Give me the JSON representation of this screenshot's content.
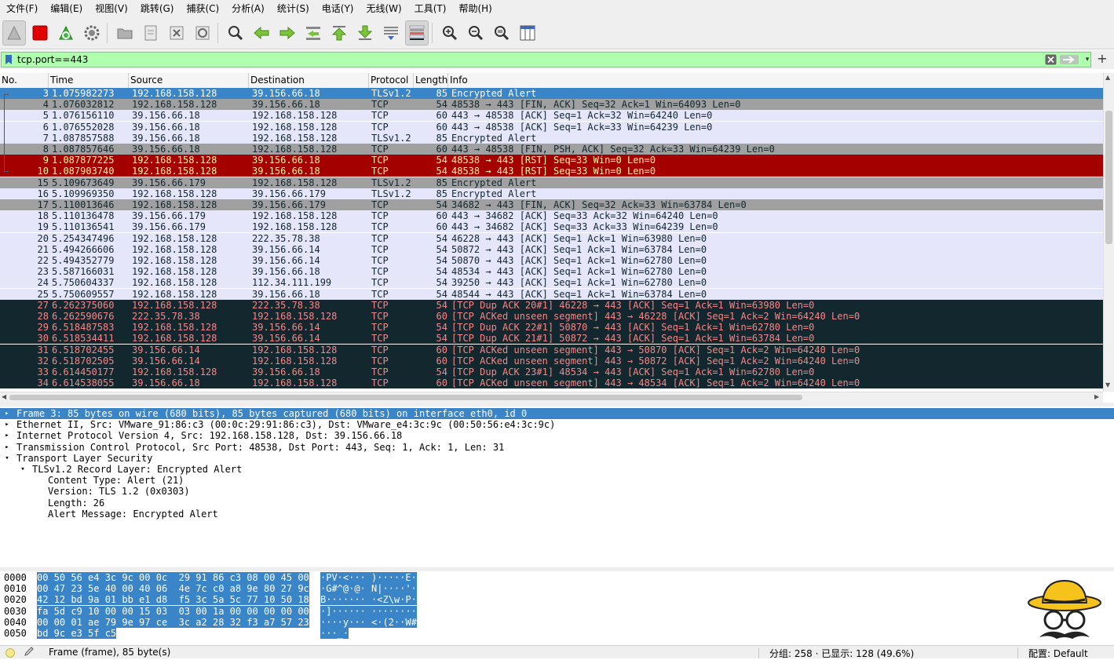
{
  "menubar": {
    "items": [
      "文件(F)",
      "编辑(E)",
      "视图(V)",
      "跳转(G)",
      "捕获(C)",
      "分析(A)",
      "统计(S)",
      "电话(Y)",
      "无线(W)",
      "工具(T)",
      "帮助(H)"
    ]
  },
  "filter": {
    "value": "tcp.port==443",
    "accent_color": "#afffaf"
  },
  "packet_list": {
    "columns": [
      "No.",
      "Time",
      "Source",
      "Destination",
      "Protocol",
      "Length",
      "Info"
    ],
    "rows": [
      {
        "no": "3",
        "time": "1.075982273",
        "src": "192.168.158.128",
        "dst": "39.156.66.18",
        "proto": "TLSv1.2",
        "len": "85",
        "info": "Encrypted Alert",
        "style": "selected"
      },
      {
        "no": "4",
        "time": "1.076032812",
        "src": "192.168.158.128",
        "dst": "39.156.66.18",
        "proto": "TCP",
        "len": "54",
        "info": "48538 → 443 [FIN, ACK] Seq=32 Ack=1 Win=64093 Len=0",
        "style": "grey"
      },
      {
        "no": "5",
        "time": "1.076156110",
        "src": "39.156.66.18",
        "dst": "192.168.158.128",
        "proto": "TCP",
        "len": "60",
        "info": "443 → 48538 [ACK] Seq=1 Ack=32 Win=64240 Len=0",
        "style": "lavender"
      },
      {
        "no": "6",
        "time": "1.076552028",
        "src": "39.156.66.18",
        "dst": "192.168.158.128",
        "proto": "TCP",
        "len": "60",
        "info": "443 → 48538 [ACK] Seq=1 Ack=33 Win=64239 Len=0",
        "style": "lavender"
      },
      {
        "no": "7",
        "time": "1.087857588",
        "src": "39.156.66.18",
        "dst": "192.168.158.128",
        "proto": "TLSv1.2",
        "len": "85",
        "info": "Encrypted Alert",
        "style": "lavender"
      },
      {
        "no": "8",
        "time": "1.087857646",
        "src": "39.156.66.18",
        "dst": "192.168.158.128",
        "proto": "TCP",
        "len": "60",
        "info": "443 → 48538 [FIN, PSH, ACK] Seq=32 Ack=33 Win=64239 Len=0",
        "style": "grey"
      },
      {
        "no": "9",
        "time": "1.087877225",
        "src": "192.168.158.128",
        "dst": "39.156.66.18",
        "proto": "TCP",
        "len": "54",
        "info": "48538 → 443 [RST] Seq=33 Win=0 Len=0",
        "style": "red"
      },
      {
        "no": "10",
        "time": "1.087903740",
        "src": "192.168.158.128",
        "dst": "39.156.66.18",
        "proto": "TCP",
        "len": "54",
        "info": "48538 → 443 [RST] Seq=33 Win=0 Len=0",
        "style": "red"
      },
      {
        "no": "15",
        "time": "5.109673649",
        "src": "39.156.66.179",
        "dst": "192.168.158.128",
        "proto": "TLSv1.2",
        "len": "85",
        "info": "Encrypted Alert",
        "style": "grey"
      },
      {
        "no": "16",
        "time": "5.109969350",
        "src": "192.168.158.128",
        "dst": "39.156.66.179",
        "proto": "TLSv1.2",
        "len": "85",
        "info": "Encrypted Alert",
        "style": "lavender"
      },
      {
        "no": "17",
        "time": "5.110013646",
        "src": "192.168.158.128",
        "dst": "39.156.66.179",
        "proto": "TCP",
        "len": "54",
        "info": "34682 → 443 [FIN, ACK] Seq=32 Ack=33 Win=63784 Len=0",
        "style": "grey"
      },
      {
        "no": "18",
        "time": "5.110136478",
        "src": "39.156.66.179",
        "dst": "192.168.158.128",
        "proto": "TCP",
        "len": "60",
        "info": "443 → 34682 [ACK] Seq=33 Ack=32 Win=64240 Len=0",
        "style": "lavender"
      },
      {
        "no": "19",
        "time": "5.110136541",
        "src": "39.156.66.179",
        "dst": "192.168.158.128",
        "proto": "TCP",
        "len": "60",
        "info": "443 → 34682 [ACK] Seq=33 Ack=33 Win=64239 Len=0",
        "style": "lavender"
      },
      {
        "no": "20",
        "time": "5.254347496",
        "src": "192.168.158.128",
        "dst": "222.35.78.38",
        "proto": "TCP",
        "len": "54",
        "info": "46228 → 443 [ACK] Seq=1 Ack=1 Win=63980 Len=0",
        "style": "lavender"
      },
      {
        "no": "21",
        "time": "5.494266606",
        "src": "192.168.158.128",
        "dst": "39.156.66.14",
        "proto": "TCP",
        "len": "54",
        "info": "50872 → 443 [ACK] Seq=1 Ack=1 Win=63784 Len=0",
        "style": "lavender"
      },
      {
        "no": "22",
        "time": "5.494352779",
        "src": "192.168.158.128",
        "dst": "39.156.66.14",
        "proto": "TCP",
        "len": "54",
        "info": "50870 → 443 [ACK] Seq=1 Ack=1 Win=62780 Len=0",
        "style": "lavender"
      },
      {
        "no": "23",
        "time": "5.587166031",
        "src": "192.168.158.128",
        "dst": "39.156.66.18",
        "proto": "TCP",
        "len": "54",
        "info": "48534 → 443 [ACK] Seq=1 Ack=1 Win=62780 Len=0",
        "style": "lavender"
      },
      {
        "no": "24",
        "time": "5.750604337",
        "src": "192.168.158.128",
        "dst": "112.34.111.199",
        "proto": "TCP",
        "len": "54",
        "info": "39250 → 443 [ACK] Seq=1 Ack=1 Win=62780 Len=0",
        "style": "lavender"
      },
      {
        "no": "25",
        "time": "5.750609557",
        "src": "192.168.158.128",
        "dst": "39.156.66.18",
        "proto": "TCP",
        "len": "54",
        "info": "48544 → 443 [ACK] Seq=1 Ack=1 Win=63784 Len=0",
        "style": "lavender"
      },
      {
        "no": "27",
        "time": "6.262375060",
        "src": "192.168.158.128",
        "dst": "222.35.78.38",
        "proto": "TCP",
        "len": "54",
        "info": "[TCP Dup ACK 20#1] 46228 → 443 [ACK] Seq=1 Ack=1 Win=63980 Len=0",
        "style": "dark"
      },
      {
        "no": "28",
        "time": "6.262590676",
        "src": "222.35.78.38",
        "dst": "192.168.158.128",
        "proto": "TCP",
        "len": "60",
        "info": "[TCP ACKed unseen segment] 443 → 46228 [ACK] Seq=1 Ack=2 Win=64240 Len=0",
        "style": "dark"
      },
      {
        "no": "29",
        "time": "6.518487583",
        "src": "192.168.158.128",
        "dst": "39.156.66.14",
        "proto": "TCP",
        "len": "54",
        "info": "[TCP Dup ACK 22#1] 50870 → 443 [ACK] Seq=1 Ack=1 Win=62780 Len=0",
        "style": "dark"
      },
      {
        "no": "30",
        "time": "6.518534411",
        "src": "192.168.158.128",
        "dst": "39.156.66.14",
        "proto": "TCP",
        "len": "54",
        "info": "[TCP Dup ACK 21#1] 50872 → 443 [ACK] Seq=1 Ack=1 Win=63784 Len=0",
        "style": "dark"
      },
      {
        "no": "31",
        "time": "6.518702455",
        "src": "39.156.66.14",
        "dst": "192.168.158.128",
        "proto": "TCP",
        "len": "60",
        "info": "[TCP ACKed unseen segment] 443 → 50870 [ACK] Seq=1 Ack=2 Win=64240 Len=0",
        "style": "dark"
      },
      {
        "no": "32",
        "time": "6.518702505",
        "src": "39.156.66.14",
        "dst": "192.168.158.128",
        "proto": "TCP",
        "len": "60",
        "info": "[TCP ACKed unseen segment] 443 → 50872 [ACK] Seq=1 Ack=2 Win=64240 Len=0",
        "style": "dark"
      },
      {
        "no": "33",
        "time": "6.614450177",
        "src": "192.168.158.128",
        "dst": "39.156.66.18",
        "proto": "TCP",
        "len": "54",
        "info": "[TCP Dup ACK 23#1] 48534 → 443 [ACK] Seq=1 Ack=1 Win=62780 Len=0",
        "style": "dark"
      },
      {
        "no": "34",
        "time": "6.614538055",
        "src": "39.156.66.18",
        "dst": "192.168.158.128",
        "proto": "TCP",
        "len": "60",
        "info": "[TCP ACKed unseen segment] 443 → 48534 [ACK] Seq=1 Ack=2 Win=64240 Len=0",
        "style": "dark"
      }
    ]
  },
  "details": {
    "rows": [
      {
        "indent": 0,
        "arrow": "right",
        "text": "Frame 3: 85 bytes on wire (680 bits), 85 bytes captured (680 bits) on interface eth0, id 0",
        "selected": true
      },
      {
        "indent": 0,
        "arrow": "right",
        "text": "Ethernet II, Src: VMware_91:86:c3 (00:0c:29:91:86:c3), Dst: VMware_e4:3c:9c (00:50:56:e4:3c:9c)",
        "selected": false
      },
      {
        "indent": 0,
        "arrow": "right",
        "text": "Internet Protocol Version 4, Src: 192.168.158.128, Dst: 39.156.66.18",
        "selected": false
      },
      {
        "indent": 0,
        "arrow": "right",
        "text": "Transmission Control Protocol, Src Port: 48538, Dst Port: 443, Seq: 1, Ack: 1, Len: 31",
        "selected": false
      },
      {
        "indent": 0,
        "arrow": "down",
        "text": "Transport Layer Security",
        "selected": false
      },
      {
        "indent": 1,
        "arrow": "down",
        "text": "TLSv1.2 Record Layer: Encrypted Alert",
        "selected": false
      },
      {
        "indent": 2,
        "arrow": "",
        "text": "Content Type: Alert (21)",
        "selected": false
      },
      {
        "indent": 2,
        "arrow": "",
        "text": "Version: TLS 1.2 (0x0303)",
        "selected": false
      },
      {
        "indent": 2,
        "arrow": "",
        "text": "Length: 26",
        "selected": false
      },
      {
        "indent": 2,
        "arrow": "",
        "text": "Alert Message: Encrypted Alert",
        "selected": false
      }
    ]
  },
  "bytes": {
    "rows": [
      {
        "offset": "0000",
        "hex": "00 50 56 e4 3c 9c 00 0c  29 91 86 c3 08 00 45 00",
        "ascii": "·PV·<··· )·····E·"
      },
      {
        "offset": "0010",
        "hex": "00 47 23 5e 40 00 40 06  4e 7c c0 a8 9e 80 27 9c",
        "ascii": "·G#^@·@· N|····'·"
      },
      {
        "offset": "0020",
        "hex": "42 12 bd 9a 01 bb e1 d8  f5 3c 5a 5c 77 10 50 18",
        "ascii": "B······· ·<Z\\w·P·"
      },
      {
        "offset": "0030",
        "hex": "fa 5d c9 10 00 00 15 03  03 00 1a 00 00 00 00 00",
        "ascii": "·]······ ········"
      },
      {
        "offset": "0040",
        "hex": "00 00 01 ae 79 9e 97 ce  3c a2 28 32 f3 a7 57 23",
        "ascii": "····y··· <·(2··W#"
      },
      {
        "offset": "0050",
        "hex": "bd 9c e3 5f c5",
        "ascii": "···_·"
      }
    ]
  },
  "statusbar": {
    "frame_info": "Frame (frame), 85 byte(s)",
    "packets": "分组: 258 · 已显示: 128 (49.6%)",
    "profile": "配置: Default"
  },
  "colors": {
    "selected": "#3a84c8",
    "lavender": "#e6e6fa",
    "grey": "#a0a0a0",
    "red": "#a40000",
    "dark": "#12272e"
  }
}
